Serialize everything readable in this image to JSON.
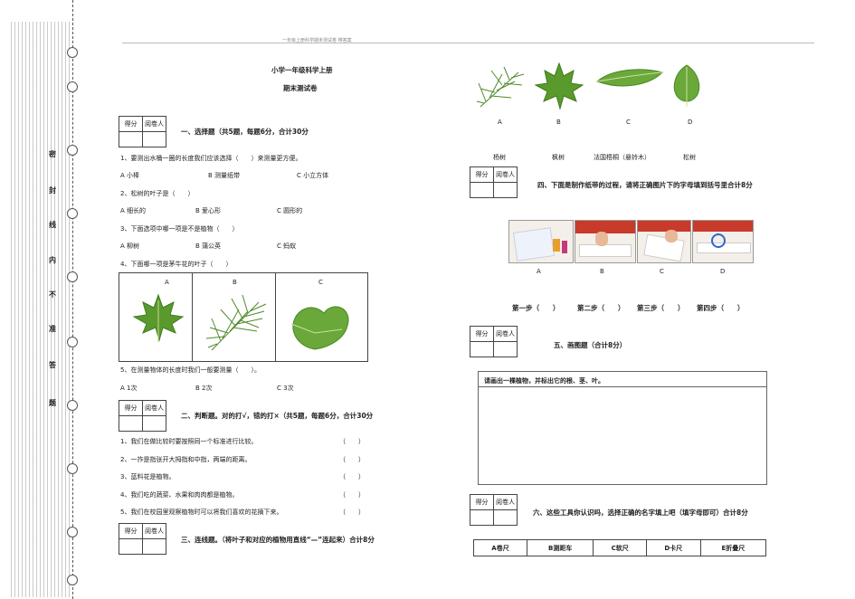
{
  "header": {
    "running_title": "一年级上册科学期末测试卷 带答案"
  },
  "margin_chars": [
    "密",
    "封",
    "线",
    "内",
    "不",
    "准",
    "答",
    "题"
  ],
  "title": {
    "line1": "小学一年级科学上册",
    "line2": "期末测试卷"
  },
  "score_box": {
    "col1": "得分",
    "col2": "阅卷人"
  },
  "section1": {
    "heading": "一、选择题（共5题，每题6分，合计30分",
    "q1": "1、要测出水桶一圈的长度我们应该选择（　　）来测量更方便。",
    "q1_opts": [
      "A 小棒",
      "B 测量纸带",
      "C 小立方体"
    ],
    "q2": "2、松树的叶子是（　　）",
    "q2_opts": [
      "A 细长的",
      "B 爱心形",
      "C 圆形的"
    ],
    "q3": "3、下面选项中哪一项是不是植物（　　）",
    "q3_opts": [
      "A 柳树",
      "B 蒲公英",
      "C 蚂蚁"
    ],
    "q4": "4、下面哪一项是茅牛花的叶子（　　）",
    "q4_labels": [
      "A",
      "B",
      "C"
    ],
    "q5": "5、在测量物体的长度时我们一般要测量（　　）。",
    "q5_opts": [
      "A 1次",
      "B 2次",
      "C 3次"
    ]
  },
  "section2": {
    "heading": "二、判断题。对的打√，错的打×（共5题，每题6分，合计30分",
    "items": [
      "1、我们在做比较时要按照同一个标准进行比较。",
      "2、一拃是指张开大拇指和中指，两端的距离。",
      "3、蓝料花是植物。",
      "4、我们吃的蔬菜、水果和肉肉都是植物。",
      "5、我们在校园里观察植物时可以将我们喜欢的花摘下来。"
    ],
    "paren": "（　　）"
  },
  "section3": {
    "heading": "三、连线题。（将叶子和对应的植物用直线“—”连起来）合计8分",
    "leaf_labels": [
      "A",
      "B",
      "C",
      "D"
    ],
    "plant_names": [
      "杨树",
      "枫树",
      "法国梧桐（悬铃木）",
      "松树"
    ]
  },
  "section4": {
    "heading": "四、下面是制作纸带的过程，请将正确图片下的字母填到括号里合计8分",
    "photo_labels": [
      "A",
      "B",
      "C",
      "D"
    ],
    "steps": [
      "第一步（　　）",
      "第二步（　　）",
      "第三步（　　）",
      "第四步（　　）"
    ]
  },
  "section5": {
    "heading": "五、画图题（合计8分）",
    "prompt": "请画出一棵植物，并标出它的根、茎、叶。"
  },
  "section6": {
    "heading": "六、这些工具你认识吗，选择正确的名字填上吧（填字母即可）合计8分",
    "tools": [
      "A卷尺",
      "B测距车",
      "C软尺",
      "D卡尺",
      "E折叠尺"
    ]
  }
}
